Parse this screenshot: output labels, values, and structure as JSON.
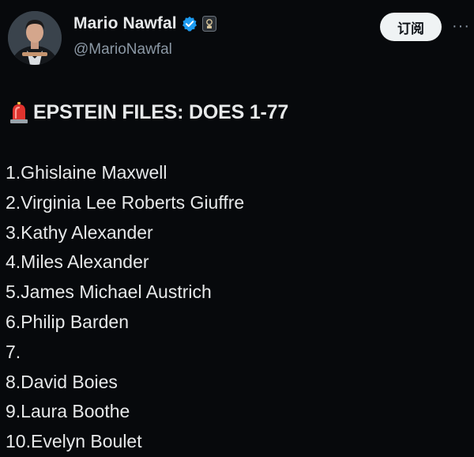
{
  "author": {
    "display_name": "Mario Nawfal",
    "handle": "@MarioNawfal",
    "verified_icon": "verified-badge-icon",
    "affiliate_icon": "affiliate-badge-icon"
  },
  "actions": {
    "subscribe_label": "订阅",
    "more_icon": "more-horizontal-icon",
    "more_glyph": "···"
  },
  "post": {
    "headline_icon": "siren-emoji-icon",
    "headline": "EPSTEIN FILES:  DOES 1-77",
    "names": [
      "1.Ghislaine Maxwell",
      "2.Virginia Lee Roberts Giuffre",
      "3.Kathy Alexander",
      "4.Miles Alexander",
      "5.James Michael Austrich",
      "6.Philip Barden",
      "7.",
      "8.David Boies",
      "9.Laura Boothe",
      "10.Evelyn Boulet"
    ]
  },
  "colors": {
    "background": "#07090c",
    "text": "#e7e9ea",
    "secondary_text": "#8b98a5",
    "verified_blue": "#1d9bf0",
    "button_bg": "#eff3f4",
    "siren_red": "#e0332e"
  }
}
